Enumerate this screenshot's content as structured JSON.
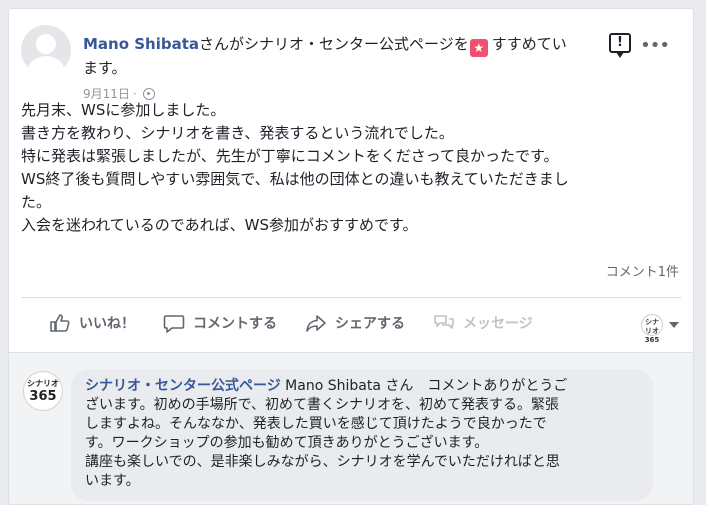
{
  "post": {
    "author": "Mano Shibata",
    "header_suffix_1": "さんがシナリオ・センター公式ページを",
    "header_suffix_2": "すすめてい",
    "header_wrap": "ます。",
    "date": "9月11日",
    "date_sep": "·",
    "body": [
      "先月末、WSに参加しました。",
      "書き方を教わり、シナリオを書き、発表するという流れでした。",
      "特に発表は緊張しましたが、先生が丁寧にコメントをくださって良かったです。",
      "WS終了後も質問しやすい雰囲気で、私は他の団体との違いも教えていただきまし",
      "た。",
      "入会を迷われているのであれば、WS参加がおすすめです。"
    ],
    "comment_count": "コメント1件"
  },
  "actions": {
    "like": "いいね！",
    "comment": "コメントする",
    "share": "シェアする",
    "message": "メッセージ"
  },
  "page_logo": {
    "line1": "シナリオ",
    "line2": "365"
  },
  "comment": {
    "author": "シナリオ・センター公式ページ",
    "lines": [
      " Mano Shibata さん　コメントありがとうご",
      "ざいます。初めの手場所で、初めて書くシナリオを、初めて発表する。緊張",
      "しますよね。そんななか、発表した買いを感じて頂けたようで良かったで",
      "す。ワークショップの参加も勧めて頂きありがとうございます。",
      "講座も楽しいでの、是非楽しみながら、シナリオを学んでいただければと思",
      "います。"
    ]
  },
  "colors": {
    "link": "#385898",
    "badge": "#f0506e",
    "muted": "#90949c"
  }
}
